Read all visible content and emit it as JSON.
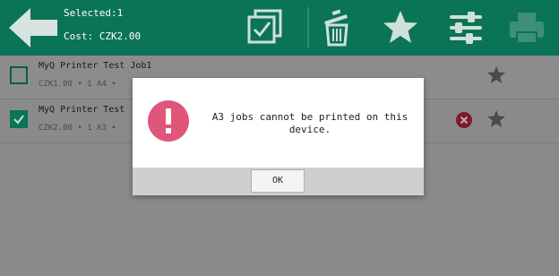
{
  "header": {
    "selected_text": "Selected:1",
    "cost_text": "Cost: CZK2.00",
    "color": "#0b7356",
    "actions": [
      "back-icon",
      "select-all-icon",
      "delete-icon",
      "favorite-icon",
      "settings-icon",
      "print-icon"
    ]
  },
  "jobs": [
    {
      "name": "MyQ Printer Test Job1",
      "meta": "CZK1.00 • 1 A4 •",
      "checked": false
    },
    {
      "name": "MyQ Printer Test",
      "meta": "CZK2.00 • 1 A3 •",
      "checked": true
    }
  ],
  "dialog": {
    "message": "A3 jobs cannot be printed on this device.",
    "ok_label": "OK",
    "icon_color": "#e0567a"
  }
}
